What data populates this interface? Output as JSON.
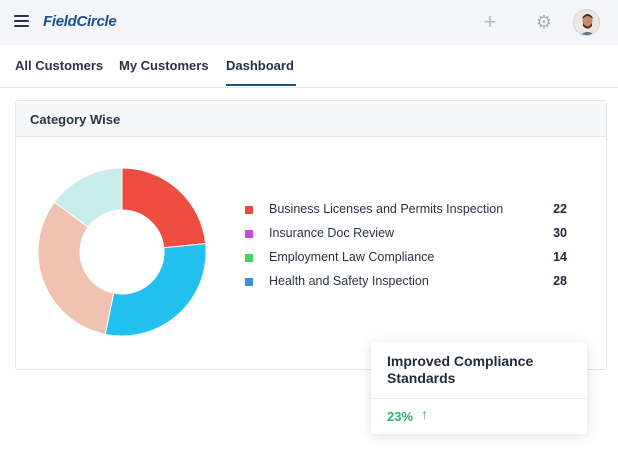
{
  "header": {
    "logo": "FieldCircle",
    "icons": [
      "hamburger-icon",
      "plus-icon",
      "gear-icon",
      "avatar"
    ]
  },
  "tabs": [
    {
      "label": "All Customers",
      "active": false
    },
    {
      "label": "My Customers",
      "active": false
    },
    {
      "label": "Dashboard",
      "active": true
    }
  ],
  "card": {
    "title": "Category Wise"
  },
  "chart_data": {
    "type": "pie",
    "title": "Category Wise",
    "categories": [
      "Business Licenses and Permits Inspection",
      "Insurance Doc Review",
      "Employment Law Compliance",
      "Health and Safety Inspection"
    ],
    "values": [
      22,
      30,
      14,
      28
    ],
    "legend_colors": [
      "#e94b3c",
      "#c94bdc",
      "#4ad35a",
      "#3c8fe4"
    ],
    "slice_colors": [
      "#ef4b3f",
      "#f0c2b2",
      "#c8ecea",
      "#21c0ee"
    ],
    "legend_position": "right"
  },
  "popup": {
    "title": "Improved Compliance Standards",
    "stat": "23%",
    "arrow": "↑"
  },
  "colors": {
    "brand": "#1b4f8f",
    "accent_underline": "#1f4f8b",
    "positive": "#2db46b"
  }
}
